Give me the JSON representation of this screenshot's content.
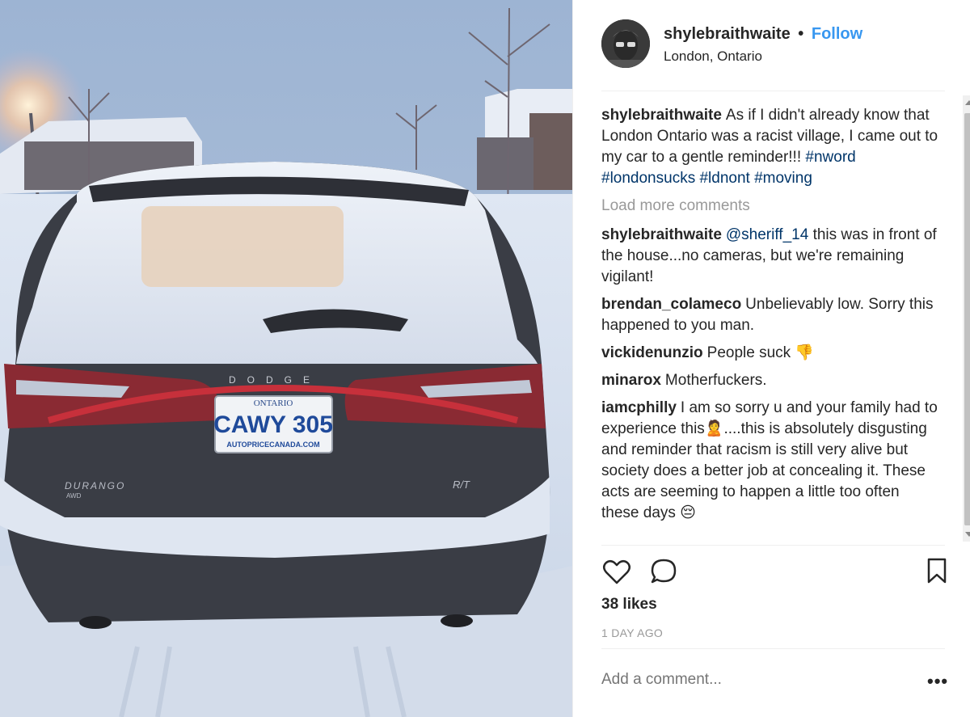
{
  "post": {
    "username": "shylebraithwaite",
    "separator": "•",
    "follow_label": "Follow",
    "location": "London, Ontario",
    "plate": {
      "province": "ONTARIO",
      "number": "CAWY 305",
      "dealer": "AUTOPRICECANADA.COM",
      "badge_left": "DURANGO",
      "badge_sub": "AWD",
      "badge_right": "R/T",
      "brand": "DODGE"
    }
  },
  "caption": {
    "user": "shylebraithwaite",
    "text": "As if I didn't already know that London Ontario was a racist village, I came out to my car to a gentle reminder!!!",
    "tags": "#nword #londonsucks #ldnont #moving"
  },
  "load_more_label": "Load more comments",
  "comments": [
    {
      "user": "shylebraithwaite",
      "mention": "@sheriff_14",
      "text": "this was in front of the house...no cameras, but we're remaining vigilant!"
    },
    {
      "user": "brendan_colameco",
      "text": "Unbelievably low. Sorry this happened to you man."
    },
    {
      "user": "vickidenunzio",
      "text": "People suck 👎"
    },
    {
      "user": "minarox",
      "text": "Motherfuckers."
    },
    {
      "user": "iamcphilly",
      "text": "I am so sorry u and your family had to experience this🙎....this is absolutely disgusting and reminder that racism is still very alive but society does a better job at concealing it. These acts are seeming to happen a little too often these days 😔"
    }
  ],
  "likes": "38 likes",
  "timestamp": "1 DAY AGO",
  "add_comment_placeholder": "Add a comment...",
  "more_label": "•••",
  "icons": [
    "heart-icon",
    "comment-icon",
    "bookmark-icon",
    "more-options-icon"
  ],
  "colors": {
    "link": "#3897f0",
    "hashtag": "#003569",
    "muted": "#999999",
    "text": "#262626"
  }
}
